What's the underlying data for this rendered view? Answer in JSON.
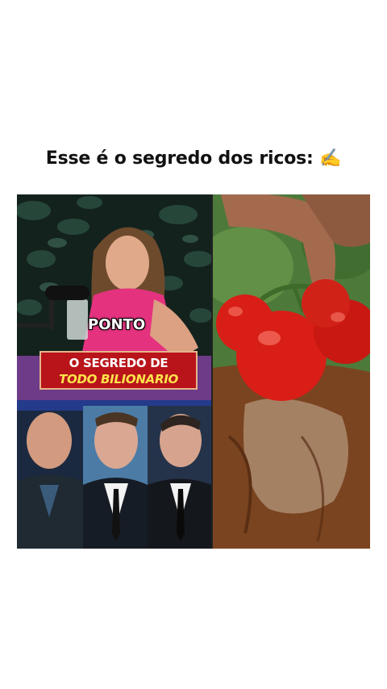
{
  "post": {
    "headline": "Esse é o segredo dos ricos: ✍️"
  },
  "left_panel": {
    "caption": "PONTO",
    "banner_line_1": "O SEGREDO DE",
    "banner_line_2": "TODO BILIONARIO"
  },
  "colors": {
    "banner_red": "#b8141a",
    "banner_yellow_text": "#ffe24a",
    "tomato_red": "#d81e16",
    "cutting_board": "#7a4420"
  },
  "icons": [
    "writing-hand-emoji",
    "microphone-icon"
  ]
}
